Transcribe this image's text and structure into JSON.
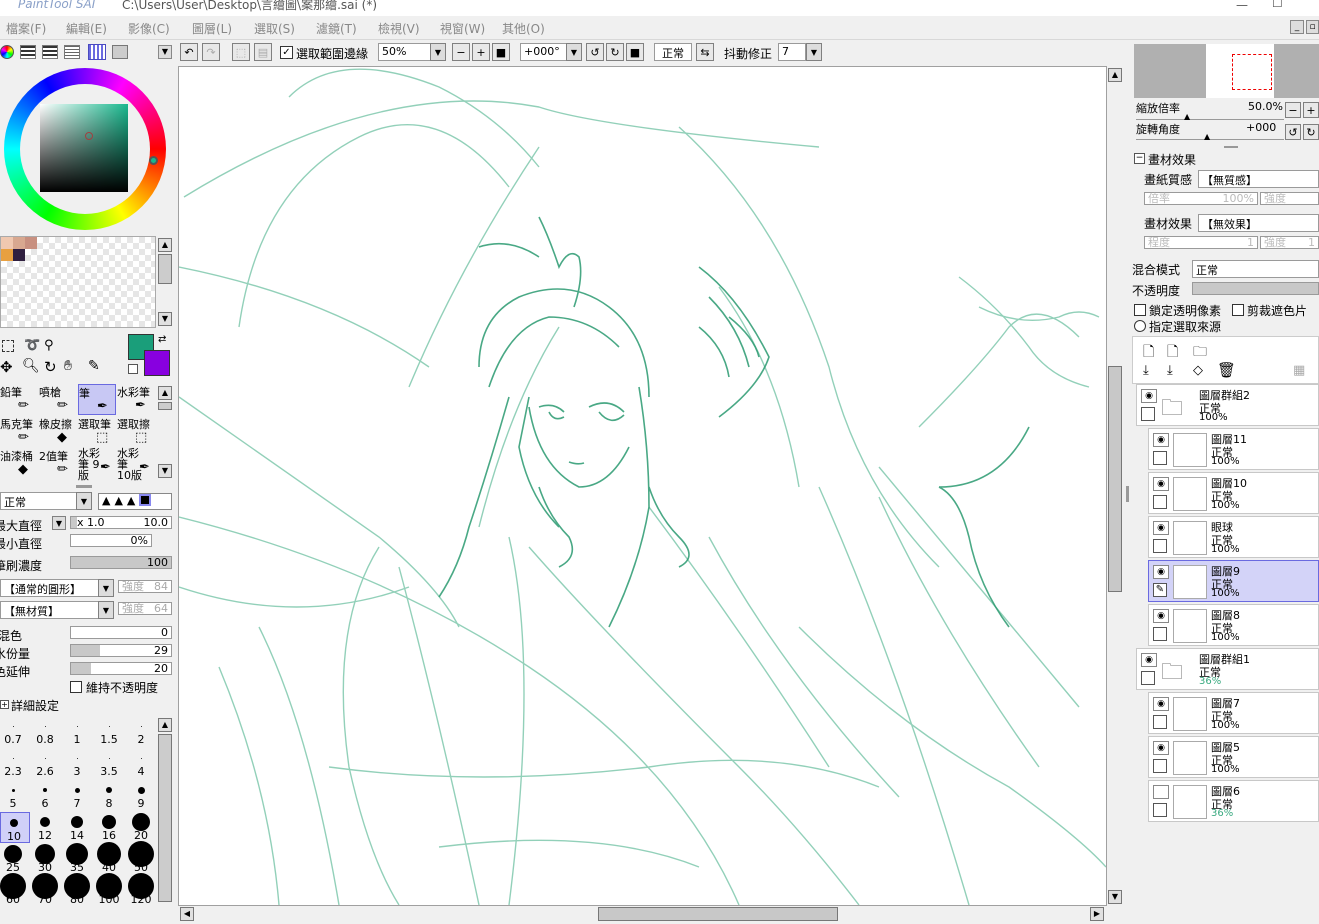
{
  "window": {
    "title": "C:\\Users\\User\\Desktop\\言繪圖\\案那繪.sai (*)",
    "logo": "PaintTool SAI"
  },
  "menu": [
    "檔案(F)",
    "編輯(E)",
    "影像(C)",
    "圖層(L)",
    "選取(S)",
    "濾鏡(T)",
    "檢視(V)",
    "視窗(W)",
    "其他(O)"
  ],
  "toolbar": {
    "antialias_label": "選取範圍邊緣",
    "zoom": "50%",
    "rotation": "+000°",
    "blend": "正常",
    "stabilizer_label": "抖動修正",
    "stabilizer": "7"
  },
  "navigator": {
    "zoom_label": "縮放倍率",
    "zoom_value": "50.0%",
    "rotate_label": "旋轉角度",
    "rotate_value": "+000"
  },
  "texture": {
    "section": "畫材效果",
    "paper_label": "畫紙質感",
    "paper_value": "【無質感】",
    "scale_label": "倍率",
    "scale_value": "100%",
    "strength_label": "強度",
    "effect_label": "畫材效果",
    "effect_value": "【無效果】",
    "level_label": "程度",
    "level_value": "1",
    "strength2_label": "強度",
    "strength2_value": "1"
  },
  "layer_props": {
    "blend_label": "混合模式",
    "blend_value": "正常",
    "opacity_label": "不透明度",
    "lock_label": "鎖定透明像素",
    "clip_label": "剪裁遮色片",
    "source_label": "指定選取來源"
  },
  "layers": [
    {
      "name": "圖層群組2",
      "mode": "正常",
      "opacity": "100%",
      "group": true,
      "selected": false
    },
    {
      "name": "圖層11",
      "mode": "正常",
      "opacity": "100%",
      "group": false,
      "selected": false
    },
    {
      "name": "圖層10",
      "mode": "正常",
      "opacity": "100%",
      "group": false,
      "selected": false
    },
    {
      "name": "眼球",
      "mode": "正常",
      "opacity": "100%",
      "group": false,
      "selected": false
    },
    {
      "name": "圖層9",
      "mode": "正常",
      "opacity": "100%",
      "group": false,
      "selected": true
    },
    {
      "name": "圖層8",
      "mode": "正常",
      "opacity": "100%",
      "group": false,
      "selected": false
    },
    {
      "name": "圖層群組1",
      "mode": "正常",
      "opacity": "36%",
      "group": true,
      "selected": false
    },
    {
      "name": "圖層7",
      "mode": "正常",
      "opacity": "100%",
      "group": false,
      "selected": false
    },
    {
      "name": "圖層5",
      "mode": "正常",
      "opacity": "100%",
      "group": false,
      "selected": false
    },
    {
      "name": "圖層6",
      "mode": "正常",
      "opacity": "36%",
      "group": false,
      "selected": false
    }
  ],
  "tools": [
    {
      "label": "鉛筆"
    },
    {
      "label": "噴槍"
    },
    {
      "label": "筆"
    },
    {
      "label": "水彩筆"
    },
    {
      "label": "馬克筆"
    },
    {
      "label": "橡皮擦"
    },
    {
      "label": "選取筆"
    },
    {
      "label": "選取擦"
    },
    {
      "label": "油漆桶"
    },
    {
      "label": "2值筆"
    },
    {
      "label": "水彩筆 9版"
    },
    {
      "label": "水彩筆 10版"
    }
  ],
  "brush": {
    "mode": "正常",
    "max_size_label": "最大直徑",
    "max_size_mult": "x 1.0",
    "max_size_value": "10.0",
    "min_size_label": "最小直徑",
    "min_size_value": "0%",
    "density_label": "筆刷濃度",
    "density_value": "100",
    "shape": "【通常的圓形】",
    "shape_strength_label": "強度",
    "shape_strength": "84",
    "texture": "【無材質】",
    "texture_strength_label": "強度",
    "texture_strength": "64",
    "blend_label": "混色",
    "blend_value": "0",
    "water_label": "水份量",
    "water_value": "29",
    "persist_label": "色延伸",
    "persist_value": "20",
    "keep_opacity_label": "維持不透明度",
    "detail_label": "詳細設定"
  },
  "brush_sizes": [
    "0.7",
    "0.8",
    "1",
    "1.5",
    "2",
    "2.3",
    "2.6",
    "3",
    "3.5",
    "4",
    "5",
    "6",
    "7",
    "8",
    "9",
    "10",
    "12",
    "14",
    "16",
    "20",
    "25",
    "30",
    "35",
    "40",
    "50",
    "60",
    "70",
    "80",
    "100",
    "120"
  ],
  "colors": {
    "primary": "#1a9e7a",
    "secondary": "#8800e0",
    "sketch": "#3aaa80"
  }
}
